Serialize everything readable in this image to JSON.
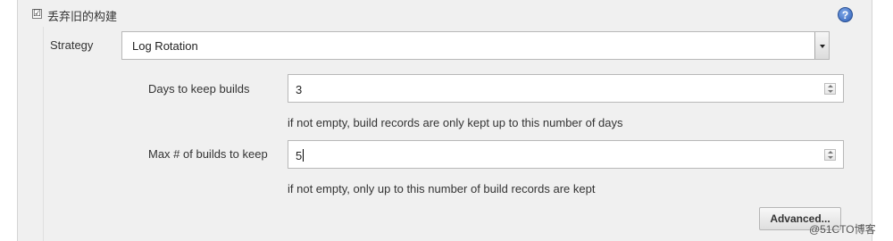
{
  "section": {
    "checkbox_mark": "☑",
    "title": "丢弃旧的构建",
    "help_icon": "?"
  },
  "strategy": {
    "label": "Strategy",
    "selected": "Log Rotation"
  },
  "days_to_keep": {
    "label": "Days to keep builds",
    "value": "3",
    "hint": "if not empty, build records are only kept up to this number of days"
  },
  "max_builds": {
    "label": "Max # of builds to keep",
    "value": "5",
    "hint": "if not empty, only up to this number of build records are kept"
  },
  "advanced_button": "Advanced...",
  "watermark": "@51CTO博客"
}
